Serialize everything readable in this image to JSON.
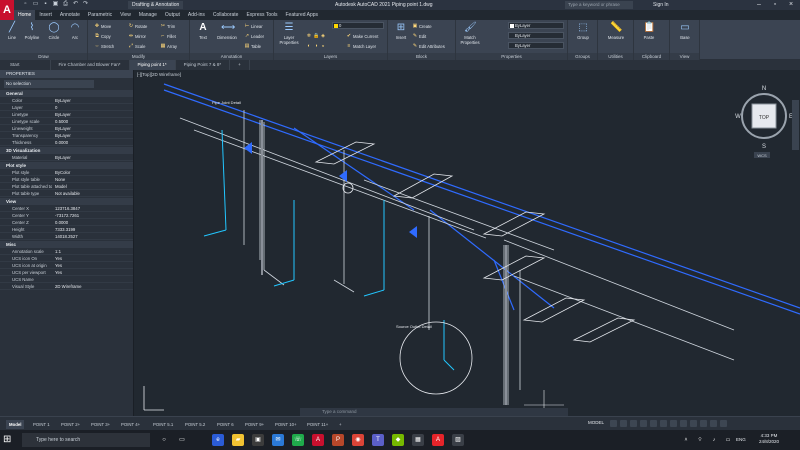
{
  "app": {
    "logo": "A",
    "workspace": "Drafting & Annotation",
    "title": "Autodesk AutoCAD 2021    Piping point 1.dwg",
    "search_placeholder": "Type a keyword or phrase",
    "sign_in": "Sign In"
  },
  "ribbon_tabs": [
    "Home",
    "Insert",
    "Annotate",
    "Parametric",
    "View",
    "Manage",
    "Output",
    "Add-ins",
    "Collaborate",
    "Express Tools",
    "Featured Apps"
  ],
  "ribbon": {
    "draw": {
      "title": "Draw",
      "line": "Line",
      "polyline": "Polyline",
      "circle": "Circle",
      "arc": "Arc"
    },
    "modify": {
      "title": "Modify",
      "move": "Move",
      "rotate": "Rotate",
      "trim": "Trim",
      "copy": "Copy",
      "mirror": "Mirror",
      "fillet": "Fillet",
      "stretch": "Stretch",
      "scale": "Scale",
      "array": "Array"
    },
    "annotation": {
      "title": "Annotation",
      "text": "Text",
      "dimension": "Dimension",
      "linear": "Linear",
      "leader": "Leader",
      "table": "Table"
    },
    "layers": {
      "title": "Layers",
      "layer_properties": "Layer Properties",
      "current_layer": "0",
      "make_current": "Make Current",
      "match_layer": "Match Layer"
    },
    "block": {
      "title": "Block",
      "insert": "Insert",
      "create": "Create",
      "edit": "Edit",
      "edit_attributes": "Edit Attributes"
    },
    "properties": {
      "title": "Properties",
      "match": "Match Properties",
      "color": "ByLayer",
      "lineweight": "ByLayer",
      "linetype": "ByLayer"
    },
    "groups": {
      "title": "Groups",
      "group": "Group"
    },
    "utilities": {
      "title": "Utilities",
      "measure": "Measure"
    },
    "clipboard": {
      "title": "Clipboard",
      "paste": "Paste"
    },
    "view": {
      "title": "View",
      "base": "Base"
    }
  },
  "doc_tabs": [
    "Start",
    "Fire Chamber and Blower Fan*",
    "Piping point 1*",
    "Piping Point 7 & 8*"
  ],
  "properties_palette": {
    "title": "PROPERTIES",
    "selection": "No selection",
    "sections": [
      {
        "name": "General",
        "rows": [
          [
            "Color",
            "ByLayer"
          ],
          [
            "Layer",
            "0"
          ],
          [
            "Linetype",
            "ByLayer"
          ],
          [
            "Linetype scale",
            "0.5000"
          ],
          [
            "Lineweight",
            "ByLayer"
          ],
          [
            "Transparency",
            "ByLayer"
          ],
          [
            "Thickness",
            "0.0000"
          ]
        ]
      },
      {
        "name": "3D Visualization",
        "rows": [
          [
            "Material",
            "ByLayer"
          ]
        ]
      },
      {
        "name": "Plot style",
        "rows": [
          [
            "Plot style",
            "ByColor"
          ],
          [
            "Plot style table",
            "None"
          ],
          [
            "Plot table attached to",
            "Model"
          ],
          [
            "Plot table type",
            "Not available"
          ]
        ]
      },
      {
        "name": "View",
        "rows": [
          [
            "Center X",
            "123716.3847"
          ],
          [
            "Center Y",
            "-73172.7261"
          ],
          [
            "Center Z",
            "0.0000"
          ],
          [
            "Height",
            "7333.3199"
          ],
          [
            "Width",
            "14018.2527"
          ]
        ]
      },
      {
        "name": "Misc",
        "rows": [
          [
            "Annotation scale",
            "1:1"
          ],
          [
            "UCS icon On",
            "Yes"
          ],
          [
            "UCS icon at origin",
            "Yes"
          ],
          [
            "UCS per viewport",
            "Yes"
          ],
          [
            "UCS Name",
            ""
          ],
          [
            "Visual Style",
            "2D Wireframe"
          ]
        ]
      }
    ]
  },
  "canvas": {
    "view_label": "[-][Top][2D Wireframe]",
    "command_placeholder": "Type a command",
    "viewcube": {
      "face": "TOP",
      "n": "N",
      "s": "S",
      "e": "E",
      "w": "W",
      "wcs": "WCS"
    },
    "labels": {
      "pipe_joint": "Pipe Joint Detail",
      "source_outlet": "Source Outlet Detail"
    }
  },
  "layout_tabs": [
    "Model",
    "POINT 1",
    "POINT 2+",
    "POINT 3+",
    "POINT 4+",
    "POINT 5.1",
    "POINT 5.2",
    "POINT 6",
    "POINT 9+",
    "POINT 10+",
    "POINT 11+"
  ],
  "status": {
    "model": "MODEL"
  },
  "taskbar": {
    "search": "Type here to search",
    "lang": "ENG",
    "time": "4:33 PM",
    "date": "24/8/2020"
  }
}
